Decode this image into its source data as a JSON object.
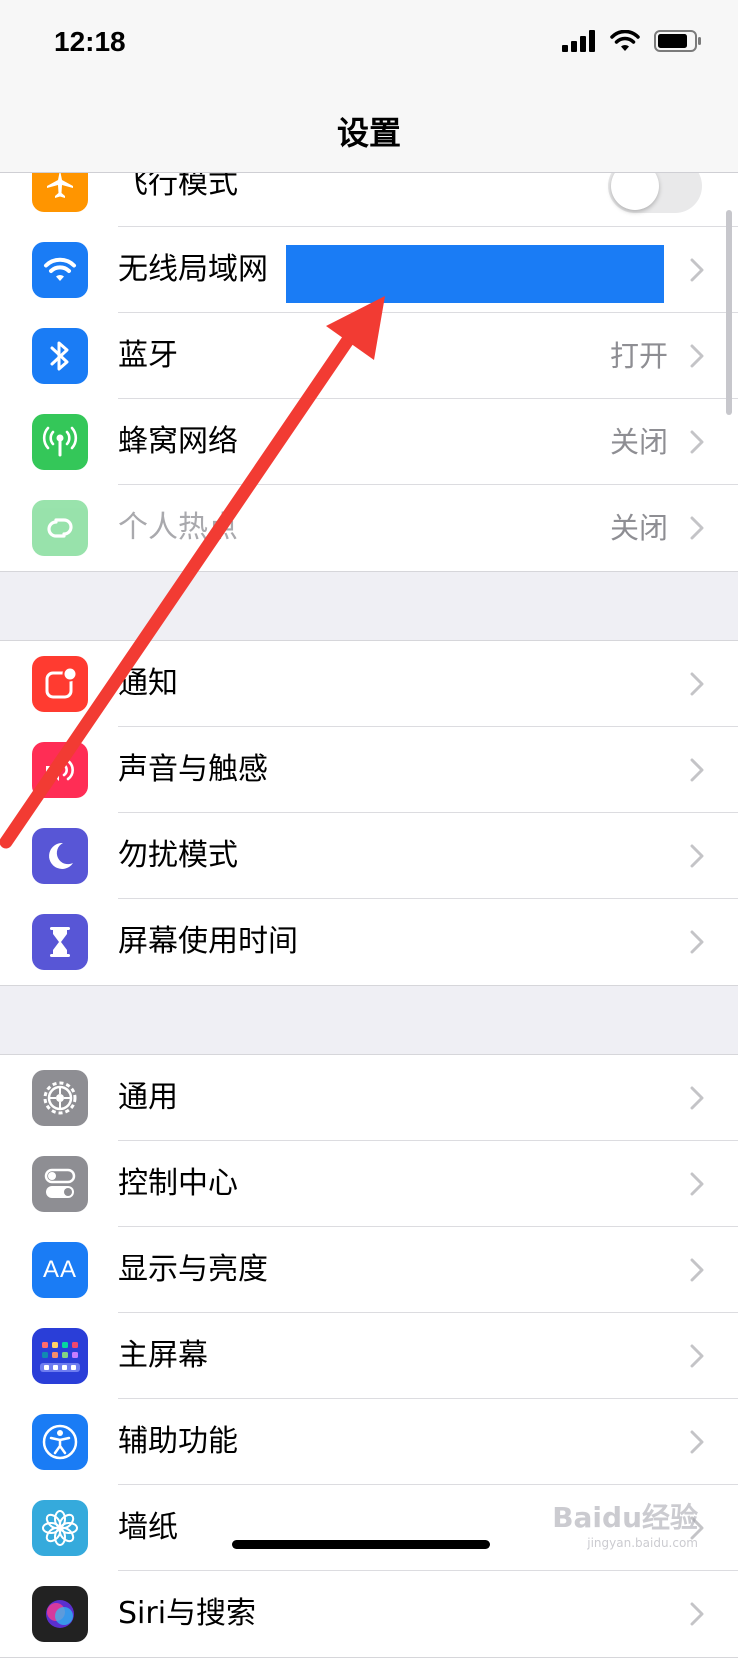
{
  "status_bar": {
    "time": "12:18"
  },
  "nav": {
    "title": "设置"
  },
  "groups": [
    {
      "rows": [
        {
          "label": "飞行模式",
          "value": "",
          "icon": "airplane-icon",
          "color": "#ff9500"
        },
        {
          "label": "无线局域网",
          "value": "",
          "icon": "wifi-icon",
          "color": "#1a7cf5"
        },
        {
          "label": "蓝牙",
          "value": "打开",
          "icon": "bluetooth-icon",
          "color": "#1a7cf5"
        },
        {
          "label": "蜂窝网络",
          "value": "关闭",
          "icon": "cellular-icon",
          "color": "#34c759"
        },
        {
          "label": "个人热点",
          "value": "关闭",
          "icon": "hotspot-icon",
          "color": "#34c759"
        }
      ]
    },
    {
      "rows": [
        {
          "label": "通知",
          "icon": "notifications-icon",
          "color": "#ff3b30"
        },
        {
          "label": "声音与触感",
          "icon": "speaker-icon",
          "color": "#ff2d55"
        },
        {
          "label": "勿扰模式",
          "icon": "moon-icon",
          "color": "#5856d6"
        },
        {
          "label": "屏幕使用时间",
          "icon": "hourglass-icon",
          "color": "#5856d6"
        }
      ]
    },
    {
      "rows": [
        {
          "label": "通用",
          "icon": "gear-icon",
          "color": "#8e8e93"
        },
        {
          "label": "控制中心",
          "icon": "switches-icon",
          "color": "#8e8e93"
        },
        {
          "label": "显示与亮度",
          "icon": "text-size-icon",
          "icon_text": "AA",
          "color": "#1a7cf5"
        },
        {
          "label": "主屏幕",
          "icon": "home-screen-icon",
          "color": "#2a3ed8"
        },
        {
          "label": "辅助功能",
          "icon": "accessibility-icon",
          "color": "#1a7cf5"
        },
        {
          "label": "墙纸",
          "icon": "flower-icon",
          "color": "#35aadc"
        },
        {
          "label": "Siri与搜索",
          "icon": "siri-icon",
          "color": "#222222"
        }
      ]
    }
  ],
  "watermark": {
    "logo": "Baidu经验",
    "url": "jingyan.baidu.com"
  }
}
